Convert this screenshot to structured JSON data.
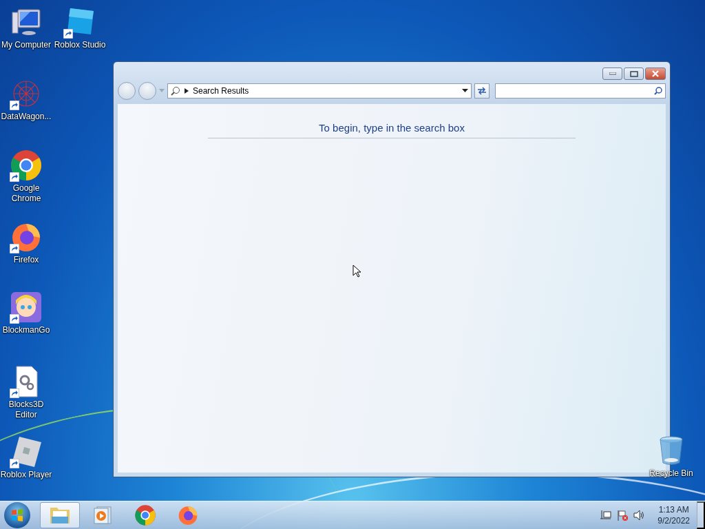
{
  "desktop_icons": [
    {
      "kind": "computer",
      "label": "My Computer",
      "shortcut": false
    },
    {
      "kind": "studio",
      "label": "Roblox Studio",
      "shortcut": true
    },
    {
      "kind": "network",
      "label": "DataWagon...",
      "shortcut": true
    },
    {
      "kind": "chrome",
      "label": "Google Chrome",
      "shortcut": true
    },
    {
      "kind": "firefox",
      "label": "Firefox",
      "shortcut": true
    },
    {
      "kind": "game",
      "label": "BlockmanGo",
      "shortcut": true
    },
    {
      "kind": "document",
      "label": "Blocks3D Editor",
      "shortcut": true
    },
    {
      "kind": "roblox",
      "label": "Roblox Player",
      "shortcut": true
    },
    {
      "kind": "recycle",
      "label": "Recycle Bin",
      "shortcut": false
    }
  ],
  "window": {
    "address": "Search Results",
    "message": "To begin, type in the search box"
  },
  "taskbar": {
    "items": [
      {
        "kind": "explorer",
        "selected": true
      },
      {
        "kind": "media",
        "selected": false
      },
      {
        "kind": "chrome",
        "selected": false
      },
      {
        "kind": "firefox",
        "selected": false
      }
    ],
    "time": "1:13 AM",
    "date": "9/2/2022"
  }
}
